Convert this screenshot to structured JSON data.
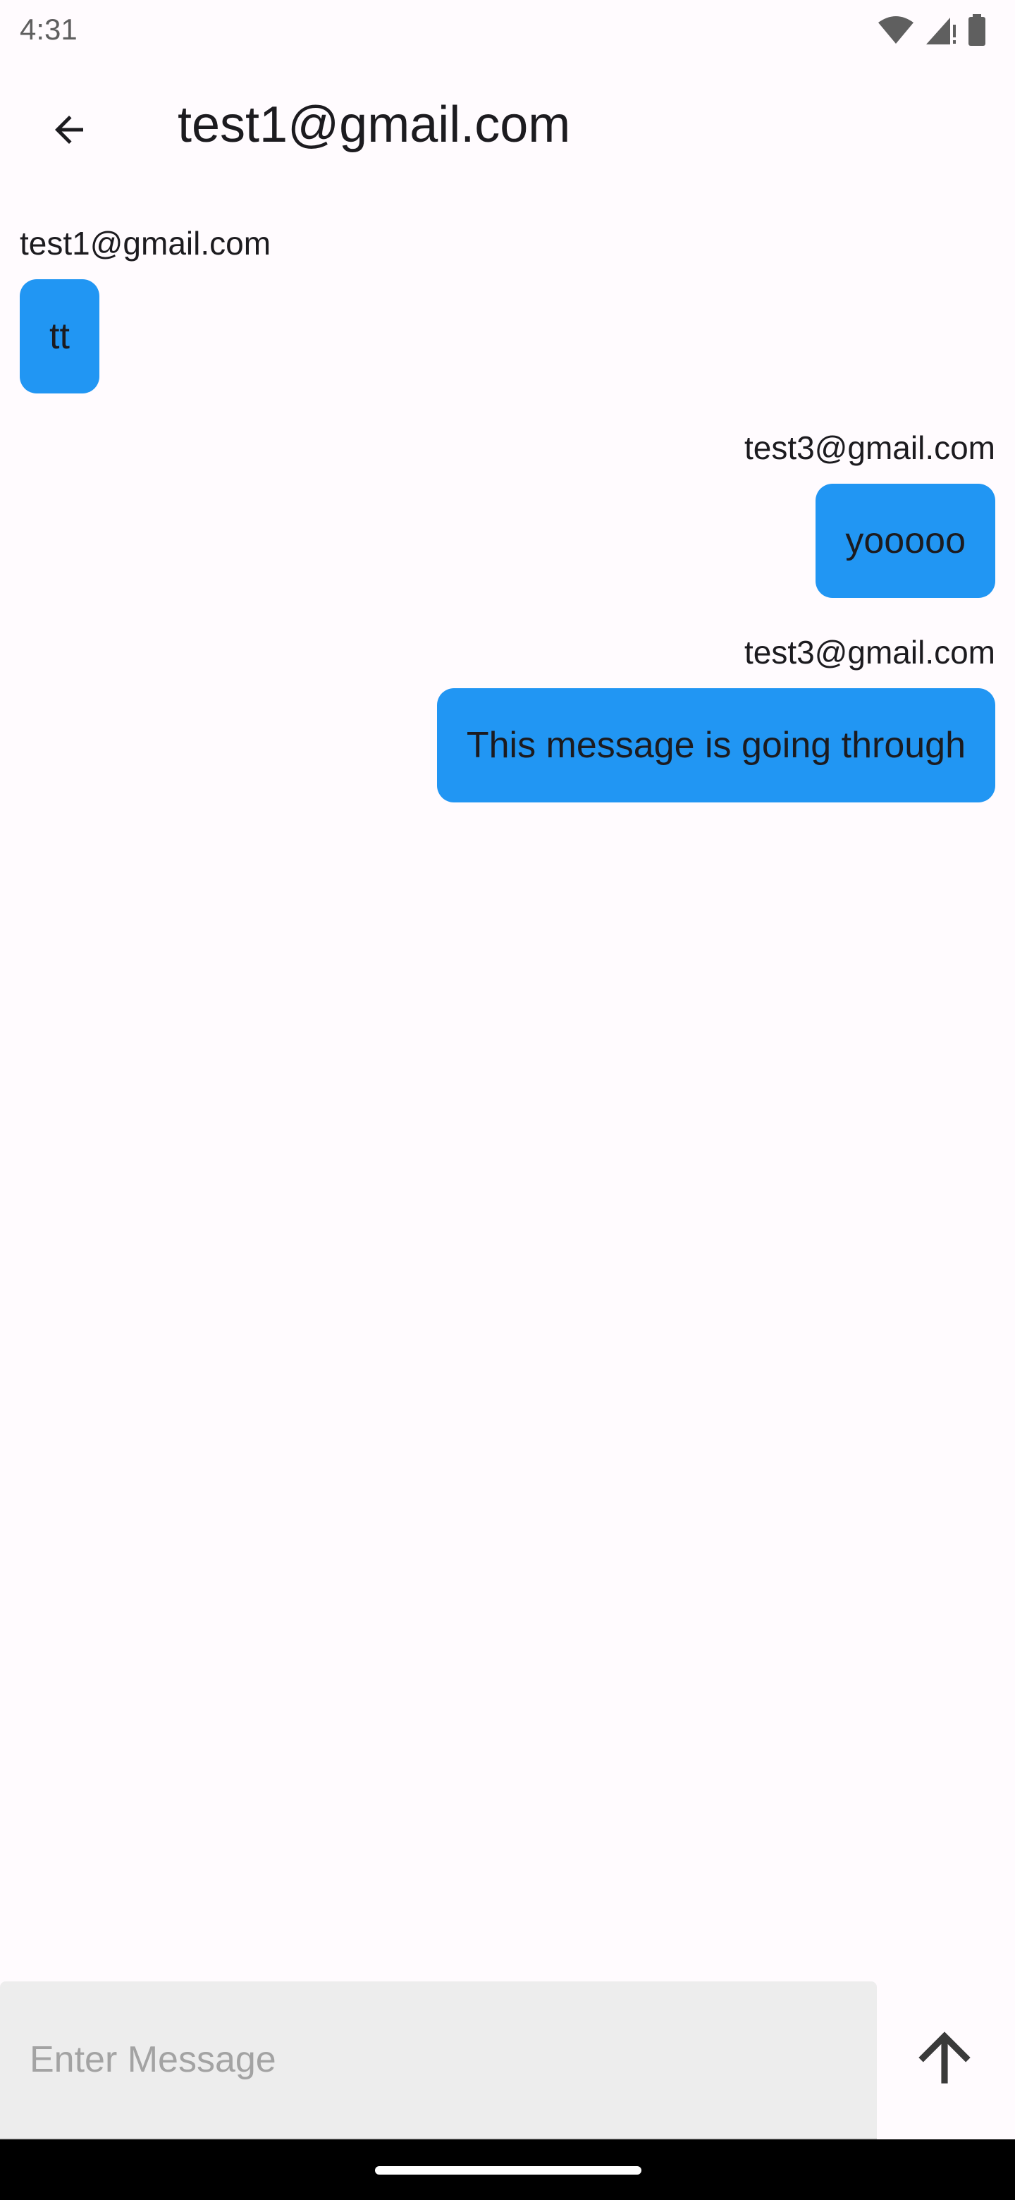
{
  "status_bar": {
    "time": "4:31",
    "icons": [
      "wifi-icon",
      "cellular-signal-icon",
      "battery-icon"
    ]
  },
  "app_bar": {
    "back_icon": "arrow-left-icon",
    "title": "test1@gmail.com"
  },
  "messages": [
    {
      "sender": "test1@gmail.com",
      "text": "tt",
      "side": "left"
    },
    {
      "sender": "test3@gmail.com",
      "text": "yooooo",
      "side": "right"
    },
    {
      "sender": "test3@gmail.com",
      "text": "This message is going through",
      "side": "right"
    }
  ],
  "composer": {
    "value": "",
    "placeholder": "Enter Message",
    "send_icon": "arrow-up-icon"
  },
  "colors": {
    "background": "#fffbfe",
    "bubble": "#2196f3",
    "input_background": "#ededed",
    "nav_bar": "#000000"
  }
}
